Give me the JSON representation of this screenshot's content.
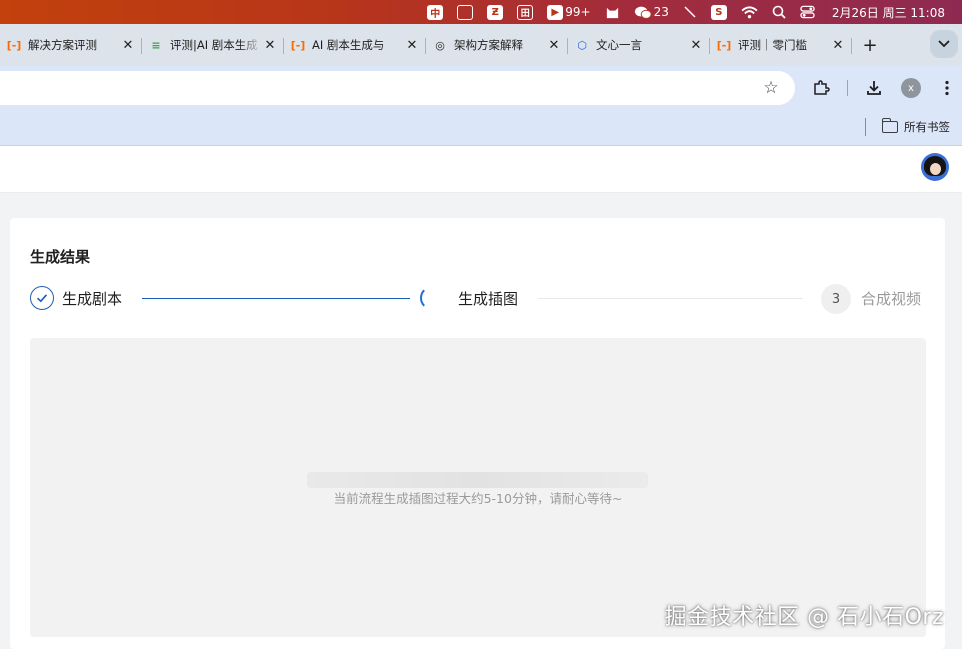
{
  "menubar": {
    "icons": [
      {
        "name": "input-method-icon",
        "glyph": "中"
      },
      {
        "name": "screen-capture-icon",
        "glyph": ""
      },
      {
        "name": "app-icon-1",
        "glyph": "Ƶ"
      },
      {
        "name": "app-icon-2",
        "glyph": "田"
      },
      {
        "name": "notification-icon",
        "glyph": ""
      }
    ],
    "badge_count": "99+",
    "wechat_count": "23",
    "datetime": "2月26日 周三  11:08"
  },
  "tabs": [
    {
      "title": "解决方案评测",
      "fav": "[-]",
      "fav_color": "#ff6a00"
    },
    {
      "title": "评测|AI 剧本生成",
      "fav": "≡",
      "fav_color": "#3fa34d"
    },
    {
      "title": "AI 剧本生成与",
      "fav": "[-]",
      "fav_color": "#ff6a00"
    },
    {
      "title": "架构方案解释",
      "fav": "◎",
      "fav_color": "#1f1f1f"
    },
    {
      "title": "文心一言",
      "fav": "⬡",
      "fav_color": "#2262e0"
    },
    {
      "title": "评测｜零门槛",
      "fav": "[-]",
      "fav_color": "#ff6a00"
    }
  ],
  "toolbar": {
    "profile_initial": "x"
  },
  "bookmarks": {
    "all_bookmarks_label": "所有书签"
  },
  "card": {
    "title": "生成结果",
    "steps": [
      {
        "label": "生成剧本",
        "state": "done"
      },
      {
        "label": "生成插图",
        "state": "in-progress"
      },
      {
        "label": "合成视频",
        "state": "pending",
        "number": "3"
      }
    ],
    "hint": "当前流程生成插图过程大约5-10分钟，请耐心等待~"
  },
  "watermark": "掘金技术社区 @ 石小石Orz",
  "colors": {
    "primary": "#1b5fb4",
    "menubar_start": "#c2410c",
    "menubar_end": "#8e2a52",
    "tabbar_bg": "#dde3ea",
    "toolbar_bg": "#dbe7f9"
  }
}
